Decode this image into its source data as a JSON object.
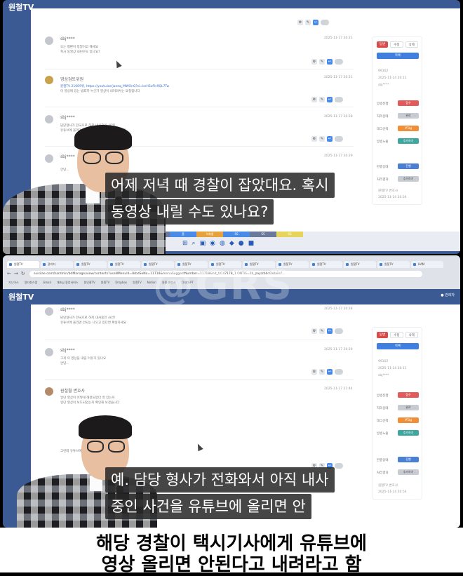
{
  "top": {
    "brand": "원철TV",
    "comments": [
      {
        "name": "sbj****",
        "lines": [
          "오는 평판이 정말이고 해세요",
          "혹시 동영상 내린수도 있나요?"
        ],
        "date": "2025-11-17 20:21"
      },
      {
        "name": "영상검토위원",
        "lines": [
          "원철TV 21669위, https://youtu.be/jaeeq_MWOnQ?si=keHSoPic9QL7Tw",
          "이 영상에 있는 범죄자 누군가 영상이 내려와서는 요청합니다"
        ],
        "link": true,
        "date": "2025-11-17 20:21"
      },
      {
        "name": "sbj****",
        "lines": [
          "담당형사가 한국으로 하지 내사중인 사건?",
          "유튜브에 올리면 안되는 나오고 있다면 확실하세요"
        ],
        "date": "2025-11-17 20:28"
      },
      {
        "name": "sbj****",
        "lines": [
          "",
          "안녕..."
        ],
        "date": "2025-11-17 20:29"
      }
    ],
    "sidebar": {
      "buttons": [
        "답변",
        "수정",
        "삭제"
      ],
      "wide": "목록",
      "meta": [
        "99102",
        "2025-11-14 20:11",
        "sbj****"
      ],
      "rows": [
        {
          "label": "방송진행",
          "pill": "접수"
        },
        {
          "label": "처리상태",
          "pill": "완료"
        },
        {
          "label": "태그선택",
          "pill": "#Tag"
        },
        {
          "label": "방송노출",
          "pill": "추가하기"
        }
      ],
      "rows2": [
        {
          "label": "완결상태",
          "pill": "진행"
        },
        {
          "label": "처리결과",
          "pill": "추가하기"
        }
      ],
      "foot": [
        "원철TV 변호사",
        "2025-11-14 20:54"
      ]
    },
    "taskbar_tabs": [
      "방송",
      "홈",
      "녹화중",
      "SS",
      "SS",
      "SS"
    ],
    "subtitle": [
      "어제 저녁 때 경찰이 잡았대요. 혹시",
      "동영상 내릴 수도 있나요?"
    ]
  },
  "bottom": {
    "tabs": [
      "원철TV",
      "관리자",
      "원철TV",
      "원철TV",
      "원철TV",
      "원철TV",
      "원철TV",
      "원철TV",
      "원철TV",
      "원철TV",
      "원철TV",
      "원철TV",
      "HAM"
    ],
    "url": "suisilae.com/hardmin/bdManage/view/contents?useNMenuId=8rbdSeNo=11718&menuSuggestNumber=11718&hit_UC47178_1 ONTiS=2b_pay/zbbdDetails?...",
    "bookmarks": [
      "지니어스",
      "알티한스랩",
      "Gmail",
      "대표님 중앙서비스",
      "원인철TV",
      "원철TV",
      "Dropbox",
      "원철TV",
      "Notion",
      "원철 변호사",
      "ChatGPT"
    ],
    "logo": "원철TV",
    "user": "● 관리자",
    "watermark": "@GRS",
    "comments": [
      {
        "name": "sbj****",
        "lines": [
          "담당형사가 한국으로 하지 내사중인 사건?",
          "유튜브에 올리면 안되는 나오고 있다면 확실하세요"
        ],
        "date": "2025-11-17 20:28"
      },
      {
        "name": "sbj****",
        "lines": [
          "그게 이 영상을 내릴 이유가 있나요",
          "안녕..."
        ],
        "date": "2025-11-17 20:29"
      },
      {
        "name": "원철월 변호사",
        "lines": [
          "일단 영상이 어떻게 해결되었다 떠 있는지",
          "일단 영상이 보도되었는지 확인해 보겠습니다"
        ],
        "date": "2025-11-17 21:44"
      },
      {
        "name": "",
        "lines": [
          "그런데 유튜브에서 그냥 먼저 내려 달라 가만 하라?",
          ""
        ],
        "date": ""
      }
    ],
    "sidebar": {
      "buttons": [
        "답변",
        "수정",
        "삭제"
      ],
      "wide": "목록",
      "meta": [
        "99102",
        "2025-11-14 20:11",
        "sbj****"
      ],
      "rows": [
        {
          "label": "방송진행",
          "pill": "접수"
        },
        {
          "label": "처리상태",
          "pill": "완료"
        },
        {
          "label": "태그선택",
          "pill": "#Tag"
        },
        {
          "label": "방송노출",
          "pill": "추가하기"
        }
      ],
      "rows2": [
        {
          "label": "완결상태",
          "pill": "진행"
        },
        {
          "label": "처리결과",
          "pill": "추가하기"
        }
      ],
      "foot": [
        "원철TV 변호사",
        "2025-11-14 20:54"
      ]
    },
    "subtitle": [
      "예. 담당 형사가 전화와서 아직 내사",
      "중인 사건을 유튜브에 올리면 안"
    ]
  },
  "caption": [
    "해당 경찰이 택시기사에게 유튜브에",
    "영상 올리면 안된다고 내려라고 함"
  ],
  "colors": {
    "header": "#3b5a94",
    "accent_red": "#d94b4b",
    "accent_blue": "#3e7fe0"
  }
}
